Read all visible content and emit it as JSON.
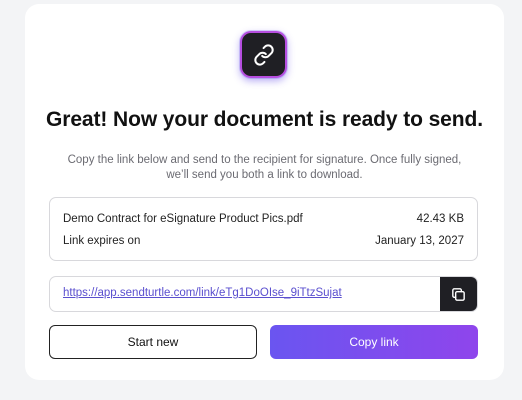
{
  "header": {
    "icon": "link-icon",
    "title": "Great! Now your document is ready to send.",
    "subtitle": "Copy the link below and send to the recipient for signature. Once fully signed, we’ll send you both a link to download."
  },
  "document": {
    "filename": "Demo Contract for eSignature Product Pics.pdf",
    "size": "42.43 KB",
    "expires_label": "Link expires on",
    "expires_date": "January 13, 2027"
  },
  "share": {
    "url": "https://app.sendturtle.com/link/eTg1DoOIse_9iTtzSujat",
    "copy_icon": "copy-icon"
  },
  "actions": {
    "start_new_label": "Start new",
    "copy_link_label": "Copy link"
  },
  "colors": {
    "accent_start": "#6a55f0",
    "accent_end": "#8f45ec",
    "link": "#5a4fcf",
    "dark": "#1f1f24"
  }
}
